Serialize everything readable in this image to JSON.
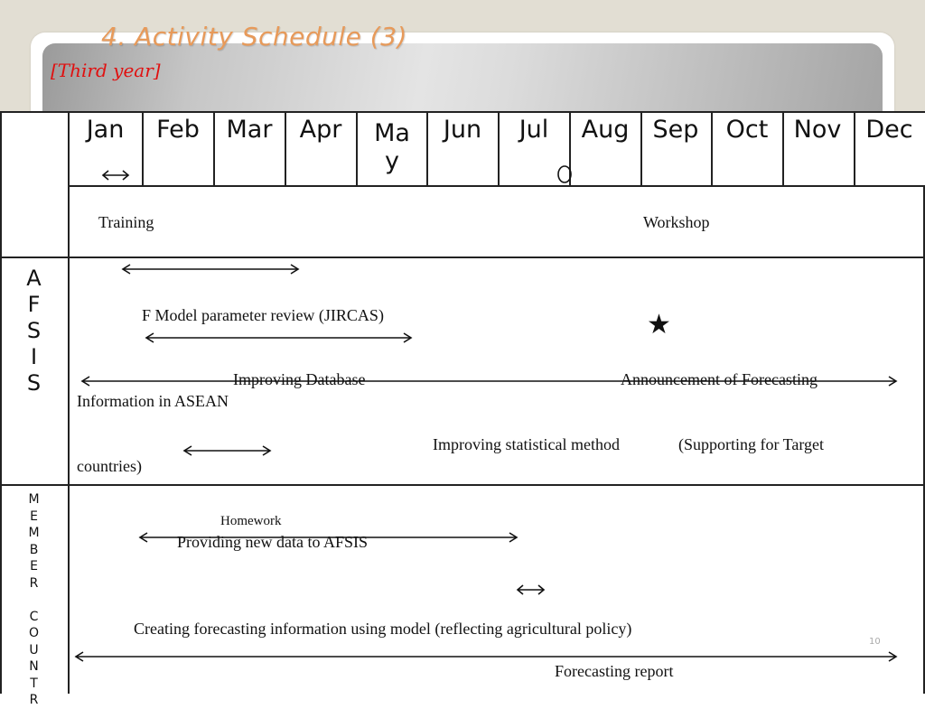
{
  "header": {
    "title": "4. Activity Schedule (3)",
    "subtitle": "[Third year]"
  },
  "months": [
    "Jan",
    "Feb",
    "Mar",
    "Apr",
    "Ma\ny",
    "Jun",
    "Jul",
    "Aug",
    "Sep",
    "Oct",
    "Nov",
    "Dec"
  ],
  "rows": {
    "top": {
      "training": "Training",
      "workshop": "Workshop"
    },
    "afsis": {
      "label": "A\nF\nS\nI\nS",
      "model_review": "F Model parameter review (JIRCAS)",
      "improving_database": "Improving Database",
      "announcement": "Announcement of Forecasting",
      "information_asean": "Information in ASEAN",
      "improving_stat": "Improving statistical method",
      "supporting": "(Supporting for Target",
      "countries": "countries)",
      "star_icon": "★"
    },
    "member": {
      "label": "M\nE\nM\nB\nE\nR\n\nC\nO\nU\nN\nT\nR",
      "homework": "Homework",
      "providing": "Providing new data to AFSIS",
      "creating": "Creating forecasting information using model (reflecting agricultural policy)",
      "report": "Forecasting report"
    }
  },
  "page_number": "10"
}
